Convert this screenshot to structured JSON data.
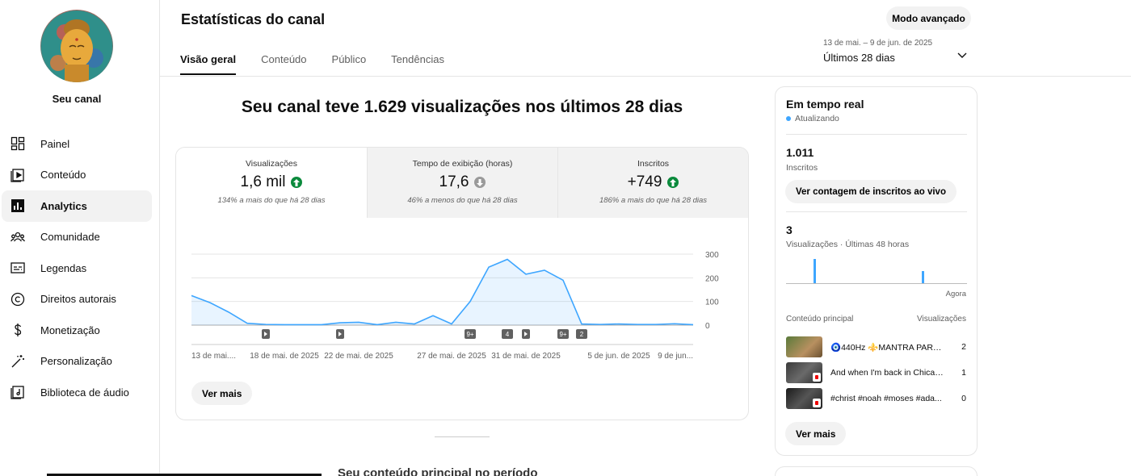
{
  "sidebar": {
    "channel_label": "Seu canal",
    "items": [
      {
        "label": "Painel",
        "icon": "dashboard-icon"
      },
      {
        "label": "Conteúdo",
        "icon": "content-icon"
      },
      {
        "label": "Analytics",
        "icon": "analytics-icon",
        "active": true
      },
      {
        "label": "Comunidade",
        "icon": "community-icon"
      },
      {
        "label": "Legendas",
        "icon": "subtitles-icon"
      },
      {
        "label": "Direitos autorais",
        "icon": "copyright-icon"
      },
      {
        "label": "Monetização",
        "icon": "monetization-icon"
      },
      {
        "label": "Personalização",
        "icon": "customization-icon"
      },
      {
        "label": "Biblioteca de áudio",
        "icon": "audio-library-icon"
      }
    ]
  },
  "header": {
    "title": "Estatísticas do canal",
    "advanced_button": "Modo avançado",
    "tabs": [
      "Visão geral",
      "Conteúdo",
      "Público",
      "Tendências"
    ],
    "active_tab": "Visão geral",
    "date_range": "13 de mai. – 9 de jun. de 2025",
    "range_label": "Últimos 28 dias"
  },
  "main": {
    "headline": "Seu canal teve 1.629 visualizações nos últimos 28 dias",
    "metrics": [
      {
        "label": "Visualizações",
        "value": "1,6 mil",
        "trend": "up",
        "comparison": "134% a mais do que há 28 dias"
      },
      {
        "label": "Tempo de exibição (horas)",
        "value": "17,6",
        "trend": "down",
        "comparison": "46% a menos do que há 28 dias"
      },
      {
        "label": "Inscritos",
        "value": "+749",
        "trend": "up",
        "comparison": "186% a mais do que há 28 dias"
      }
    ],
    "see_more": "Ver mais",
    "bottom_heading": "Seu conteúdo principal no período"
  },
  "chart_data": {
    "type": "area",
    "title": "",
    "x": [
      "13 de mai.",
      "14",
      "15",
      "16",
      "17",
      "18 de mai. de 2025",
      "19",
      "20",
      "21",
      "22 de mai. de 2025",
      "23",
      "24",
      "25",
      "26",
      "27 de mai. de 2025",
      "28",
      "29",
      "30",
      "31 de mai. de 2025",
      "1",
      "2",
      "3",
      "4",
      "5 de jun. de 2025",
      "6",
      "7",
      "8",
      "9 de jun."
    ],
    "tick_labels": [
      "13 de mai....",
      "18 de mai. de 2025",
      "22 de mai. de 2025",
      "27 de mai. de 2025",
      "31 de mai. de 2025",
      "5 de jun. de 2025",
      "9 de jun..."
    ],
    "series": [
      {
        "values": [
          125,
          95,
          55,
          8,
          3,
          2,
          2,
          2,
          10,
          12,
          2,
          12,
          5,
          40,
          5,
          100,
          245,
          278,
          215,
          232,
          190,
          5,
          3,
          5,
          3,
          3,
          6,
          2
        ]
      }
    ],
    "ylim": [
      0,
      300
    ],
    "yticks": [
      0,
      100,
      200,
      300
    ],
    "color": "#3ea6ff",
    "markers": [
      {
        "label": "shorts",
        "index": 4
      },
      {
        "label": "shorts",
        "index": 8
      },
      {
        "label": "9+",
        "index": 15
      },
      {
        "label": "4",
        "index": 17
      },
      {
        "label": "shorts",
        "index": 18
      },
      {
        "label": "9+",
        "index": 20
      },
      {
        "label": "2",
        "index": 21
      }
    ],
    "grid": true
  },
  "realtime": {
    "title": "Em tempo real",
    "updating": "Atualizando",
    "subscribers_value": "1.011",
    "subscribers_label": "Inscritos",
    "live_button": "Ver contagem de inscritos ao vivo",
    "views_value": "3",
    "views_label": "Visualizações · Últimas 48 horas",
    "now_label": "Agora",
    "bars": [
      1,
      0.5
    ],
    "top_content_label": "Conteúdo principal",
    "views_col_label": "Visualizações",
    "rows": [
      {
        "title": "🧿440Hz ⚜️MANTRA PARA ...",
        "views": "2"
      },
      {
        "title": "And when I'm back in Chicag...",
        "views": "1"
      },
      {
        "title": "#christ #noah #moses #ada...",
        "views": "0"
      }
    ],
    "see_more": "Ver mais"
  }
}
